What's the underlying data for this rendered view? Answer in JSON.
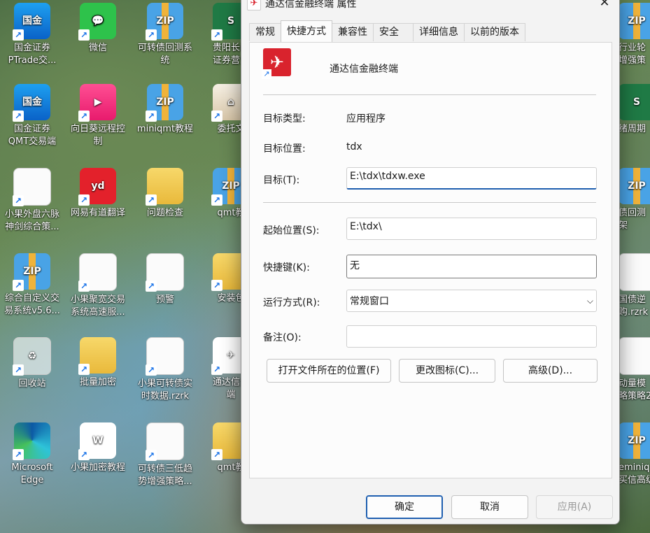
{
  "desktop": {
    "icons": [
      {
        "label": "国金证券\nPTrade交...",
        "glyph": "国金",
        "style": "i-blue"
      },
      {
        "label": "微信",
        "glyph": "💬",
        "style": "i-green"
      },
      {
        "label": "可转债回测系\n统",
        "glyph": "ZIP",
        "style": "i-zip"
      },
      {
        "label": "贵阳长岭\n证券营业",
        "glyph": "S",
        "style": "i-excel"
      },
      {
        "label": "国金证券\nQMT交易端",
        "glyph": "国金",
        "style": "i-blue"
      },
      {
        "label": "向日葵远程控\n制",
        "glyph": "▶",
        "style": "i-pink"
      },
      {
        "label": "miniqmt教程",
        "glyph": "ZIP",
        "style": "i-zip"
      },
      {
        "label": "委托文",
        "glyph": "⌂",
        "style": "i-house"
      },
      {
        "label": "小果外盘六脉\n神剑综合策...",
        "glyph": "",
        "style": "i-file"
      },
      {
        "label": "网易有道翻译",
        "glyph": "yd",
        "style": "i-red"
      },
      {
        "label": "问题检查",
        "glyph": "",
        "style": "i-folder"
      },
      {
        "label": "qmt教",
        "glyph": "ZIP",
        "style": "i-zip"
      },
      {
        "label": "综合自定义交\n易系统v5.6...",
        "glyph": "ZIP",
        "style": "i-zip"
      },
      {
        "label": "小果聚宽交易\n系统高速服...",
        "glyph": "",
        "style": "i-file"
      },
      {
        "label": "预警",
        "glyph": "",
        "style": "i-file"
      },
      {
        "label": "安装包",
        "glyph": "",
        "style": "i-folder"
      },
      {
        "label": "回收站",
        "glyph": "♻",
        "style": "i-recycle"
      },
      {
        "label": "批量加密",
        "glyph": "",
        "style": "i-folder"
      },
      {
        "label": "小果可转债实\n时数据.rzrk",
        "glyph": "",
        "style": "i-file"
      },
      {
        "label": "通达信金\n端",
        "glyph": "✈",
        "style": "i-tdx"
      },
      {
        "label": "Microsoft\nEdge",
        "glyph": "",
        "style": "i-edge"
      },
      {
        "label": "小果加密教程",
        "glyph": "W",
        "style": "i-word"
      },
      {
        "label": "可转债三低趋\n势增强策略...",
        "glyph": "",
        "style": "i-file"
      },
      {
        "label": "qmt教",
        "glyph": "",
        "style": "i-folder"
      }
    ],
    "right_icons": [
      {
        "label": "行业轮\n增强策",
        "glyph": "ZIP",
        "style": "i-zip"
      },
      {
        "label": "绪周期",
        "glyph": "S",
        "style": "i-excel"
      },
      {
        "label": "债回测\n架",
        "glyph": "ZIP",
        "style": "i-zip"
      },
      {
        "label": "国债逆\n购.rzrk",
        "glyph": "",
        "style": "i-file"
      },
      {
        "label": "动量模\n略策略2",
        "glyph": "",
        "style": "i-file"
      },
      {
        "label": "eminiq\n买信高级",
        "glyph": "ZIP",
        "style": "i-zip"
      }
    ]
  },
  "dialog": {
    "title": "通达信金融终端 属性",
    "tabs": [
      "常规",
      "快捷方式",
      "兼容性",
      "安全",
      "详细信息",
      "以前的版本"
    ],
    "active_tab": "快捷方式",
    "app_name": "通达信金融终端",
    "target_type_label": "目标类型:",
    "target_type_value": "应用程序",
    "target_location_label": "目标位置:",
    "target_location_value": "tdx",
    "target_label": "目标(T):",
    "target_value": "E:\\tdx\\tdxw.exe",
    "start_in_label": "起始位置(S):",
    "start_in_value": "E:\\tdx\\",
    "hotkey_label": "快捷键(K):",
    "hotkey_value": "无",
    "run_label": "运行方式(R):",
    "run_value": "常规窗口",
    "comment_label": "备注(O):",
    "comment_value": "",
    "open_location_button": "打开文件所在的位置(F)",
    "change_icon_button": "更改图标(C)...",
    "advanced_button": "高级(D)...",
    "ok_button": "确定",
    "cancel_button": "取消",
    "apply_button": "应用(A)"
  }
}
